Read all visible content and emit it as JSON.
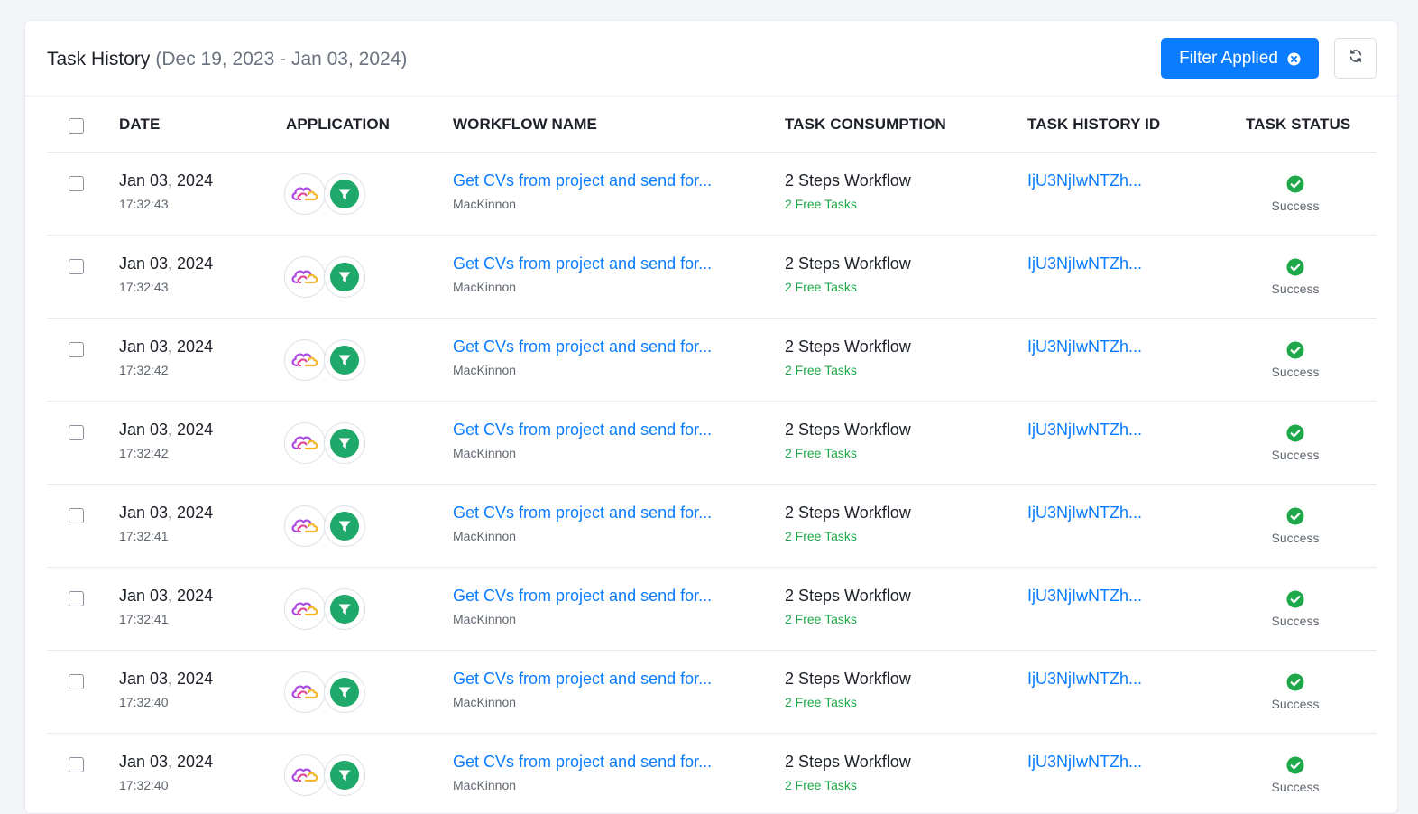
{
  "header": {
    "title": "Task History",
    "date_range": "(Dec 19, 2023 - Jan 03, 2024)",
    "filter_label": "Filter Applied",
    "refresh_icon": "refresh-icon",
    "clear_filter_icon": "close-circle-icon"
  },
  "colors": {
    "primary": "#0a7cff",
    "success": "#1ea849",
    "filter_app": "#1ea86a"
  },
  "table": {
    "columns": [
      "DATE",
      "APPLICATION",
      "WORKFLOW NAME",
      "TASK CONSUMPTION",
      "TASK HISTORY ID",
      "TASK STATUS"
    ],
    "rows": [
      {
        "date": "Jan 03, 2024",
        "time": "17:32:43",
        "workflow": "Get CVs from project and send for...",
        "owner": "MacKinnon",
        "steps": "2 Steps Workflow",
        "free": "2 Free Tasks",
        "history_id": "IjU3NjIwNTZh...",
        "status": "Success"
      },
      {
        "date": "Jan 03, 2024",
        "time": "17:32:43",
        "workflow": "Get CVs from project and send for...",
        "owner": "MacKinnon",
        "steps": "2 Steps Workflow",
        "free": "2 Free Tasks",
        "history_id": "IjU3NjIwNTZh...",
        "status": "Success"
      },
      {
        "date": "Jan 03, 2024",
        "time": "17:32:42",
        "workflow": "Get CVs from project and send for...",
        "owner": "MacKinnon",
        "steps": "2 Steps Workflow",
        "free": "2 Free Tasks",
        "history_id": "IjU3NjIwNTZh...",
        "status": "Success"
      },
      {
        "date": "Jan 03, 2024",
        "time": "17:32:42",
        "workflow": "Get CVs from project and send for...",
        "owner": "MacKinnon",
        "steps": "2 Steps Workflow",
        "free": "2 Free Tasks",
        "history_id": "IjU3NjIwNTZh...",
        "status": "Success"
      },
      {
        "date": "Jan 03, 2024",
        "time": "17:32:41",
        "workflow": "Get CVs from project and send for...",
        "owner": "MacKinnon",
        "steps": "2 Steps Workflow",
        "free": "2 Free Tasks",
        "history_id": "IjU3NjIwNTZh...",
        "status": "Success"
      },
      {
        "date": "Jan 03, 2024",
        "time": "17:32:41",
        "workflow": "Get CVs from project and send for...",
        "owner": "MacKinnon",
        "steps": "2 Steps Workflow",
        "free": "2 Free Tasks",
        "history_id": "IjU3NjIwNTZh...",
        "status": "Success"
      },
      {
        "date": "Jan 03, 2024",
        "time": "17:32:40",
        "workflow": "Get CVs from project and send for...",
        "owner": "MacKinnon",
        "steps": "2 Steps Workflow",
        "free": "2 Free Tasks",
        "history_id": "IjU3NjIwNTZh...",
        "status": "Success"
      },
      {
        "date": "Jan 03, 2024",
        "time": "17:32:40",
        "workflow": "Get CVs from project and send for...",
        "owner": "MacKinnon",
        "steps": "2 Steps Workflow",
        "free": "2 Free Tasks",
        "history_id": "IjU3NjIwNTZh...",
        "status": "Success"
      }
    ],
    "row_icons": {
      "app1": "cloud-app-icon",
      "app2": "filter-app-icon",
      "status": "check-circle-icon"
    }
  }
}
